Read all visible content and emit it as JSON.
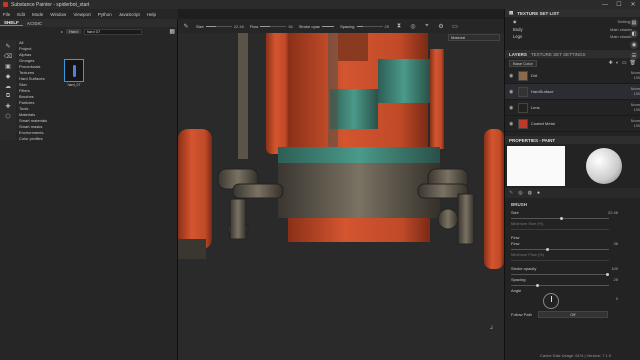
{
  "window": {
    "title": "Substance Painter - spiderbot_start",
    "minimize": "—",
    "maximize": "☐",
    "close": "✕"
  },
  "menu": [
    "File",
    "Edit",
    "Mode",
    "Window",
    "Viewport",
    "Python",
    "JavaScript",
    "Help"
  ],
  "shelf": {
    "tabs": [
      "SHELF",
      "ACIDIC"
    ],
    "search_path": "▸",
    "search_chip": "Hard",
    "search_value": "hard 07",
    "categories": [
      "All",
      "Project",
      "Alphas",
      "Grunges",
      "Procedurals",
      "Textures",
      "Hard Surfaces",
      "Skin",
      "Filters",
      "Brushes",
      "Particles",
      "Tools",
      "Materials",
      "Smart materials",
      "Smart masks",
      "Environments",
      "Color profiles"
    ],
    "asset_name": "hard_07"
  },
  "toolbar": {
    "size_label": "Size",
    "size_value": "22.46",
    "flow_label": "Flow",
    "flow_value": "36",
    "stroke_label": "Stroke opac",
    "stroke_value": "100",
    "spacing_label": "Spacing",
    "spacing_value": "25"
  },
  "viewport": {
    "material_mode": "Material",
    "status": "Cache Disk Usage: 61% | Version: 7.1.0"
  },
  "texture_set_list": {
    "title": "TEXTURE SET LIST",
    "settings": "Settings",
    "rows": [
      {
        "name": "Body",
        "shader": "Main shader"
      },
      {
        "name": "Legs",
        "shader": "Main shader"
      }
    ]
  },
  "layers": {
    "tabs": [
      "LAYERS",
      "TEXTURE SET SETTINGS"
    ],
    "channel": "Base Color",
    "items": [
      {
        "name": "Dirt",
        "blend": "Norm",
        "opacity": "100",
        "thumb": "#8a6a4a"
      },
      {
        "name": "HardSurface",
        "blend": "Norm",
        "opacity": "100",
        "thumb": "#333333"
      },
      {
        "name": "Lens",
        "blend": "Norm",
        "opacity": "100",
        "thumb": "#222222"
      },
      {
        "name": "Coated Metal",
        "blend": "Norm",
        "opacity": "100",
        "thumb": "#c0392b"
      }
    ]
  },
  "properties": {
    "title": "PROPERTIES - PAINT",
    "section": "BRUSH",
    "size_label": "Size",
    "size_value": "22.46",
    "size_min_label": "Minimum Size (%)",
    "flow_section": "Flow",
    "flow_label": "Flow",
    "flow_value": "36",
    "flow_min_label": "Minimum Flow (%)",
    "stroke_label": "Stroke opacity",
    "stroke_value": "100",
    "spacing_label": "Spacing",
    "spacing_value": "25",
    "angle_label": "Angle",
    "angle_value": "0",
    "follow_label": "Follow Path",
    "follow_value": "Off"
  },
  "colors": {
    "accent": "#3a9ad9",
    "robot_orange": "#d4552f",
    "robot_teal": "#4a9a8a",
    "metal": "#5a5448"
  }
}
